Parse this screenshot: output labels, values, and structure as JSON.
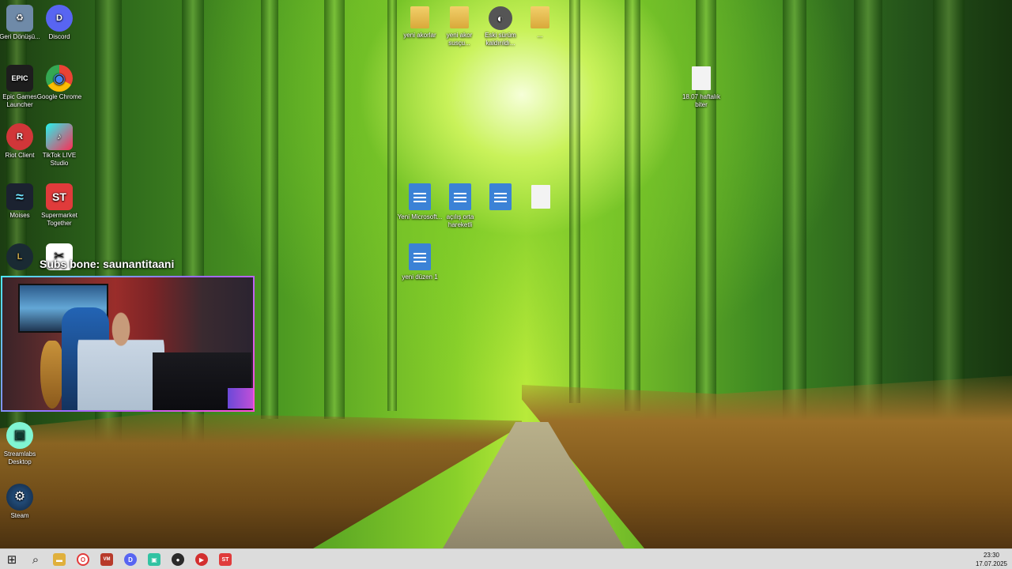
{
  "desktop_icons_left": [
    {
      "name": "recycle-bin-icon",
      "label": "Geri Dönüşü...",
      "color": "#9fc6e8",
      "glyph": "♻"
    },
    {
      "name": "discord-icon",
      "label": "Discord",
      "color": "#5865f2",
      "glyph": "D"
    },
    {
      "name": "epic-games-icon",
      "label": "Epic Games Launcher",
      "color": "#1d1d1d",
      "glyph": "EPIC"
    },
    {
      "name": "google-chrome-icon",
      "label": "Google Chrome",
      "color": "#e9433a",
      "glyph": "◉"
    },
    {
      "name": "riot-client-icon",
      "label": "Riot Client",
      "color": "#d13639",
      "glyph": "R"
    },
    {
      "name": "tiktok-live-icon",
      "label": "TikTok LIVE Studio",
      "color": "#e63a63",
      "glyph": "♪"
    },
    {
      "name": "moises-icon",
      "label": "Moises",
      "color": "#1b2230",
      "glyph": "≈"
    },
    {
      "name": "supermarket-together-icon",
      "label": "Supermarket Together",
      "color": "#e03b3b",
      "glyph": "ST"
    },
    {
      "name": "league-of-legends-icon",
      "label": "",
      "color": "#1a2a33",
      "glyph": "L"
    },
    {
      "name": "capcut-icon",
      "label": "",
      "color": "#111111",
      "glyph": "✂"
    },
    {
      "name": "streamlabs-icon",
      "label": "Streamlabs Desktop",
      "color": "#80f5d2",
      "glyph": "▣"
    },
    {
      "name": "steam-icon",
      "label": "Steam",
      "color": "#1b3b62",
      "glyph": "⚙"
    }
  ],
  "desktop_icons_top": [
    {
      "label": "yeni akorlar"
    },
    {
      "label": "yeni akor susçu..."
    },
    {
      "label": "Eski sürüm kaldırıldı..."
    },
    {
      "label": "..."
    }
  ],
  "file_1807": "18.07 haftalık biter",
  "docs": [
    {
      "label": "Yeni Microsoft..."
    },
    {
      "label": "açılış orta hareketli"
    },
    {
      "label": ""
    },
    {
      "label": ""
    }
  ],
  "doc_extra": "yeni düzen 1",
  "subscriber_text": "Subs bone: saunantitaani",
  "taskbar": {
    "items": [
      {
        "name": "start-button",
        "glyph": "⊞",
        "color": "#1a1a1a"
      },
      {
        "name": "search-button",
        "glyph": "⌕",
        "color": "#1a1a1a"
      },
      {
        "name": "file-explorer-button",
        "glyph": "▬",
        "color": "#e0b03c"
      },
      {
        "name": "opera-button",
        "glyph": "O",
        "color": "#e23b3b"
      },
      {
        "name": "voicemeeter-button",
        "glyph": "VM",
        "color": "#b83a2a"
      },
      {
        "name": "discord-taskbar-button",
        "glyph": "D",
        "color": "#5865f2"
      },
      {
        "name": "streamlabs-taskbar-button",
        "glyph": "▣",
        "color": "#31c3a2"
      },
      {
        "name": "obs-button",
        "glyph": "●",
        "color": "#2b2b2b"
      },
      {
        "name": "media-button",
        "glyph": "▶",
        "color": "#d32f2f"
      },
      {
        "name": "supermarket-taskbar-button",
        "glyph": "ST",
        "color": "#e03b3b"
      }
    ],
    "time": "23:30",
    "date": "17.07.2025"
  }
}
